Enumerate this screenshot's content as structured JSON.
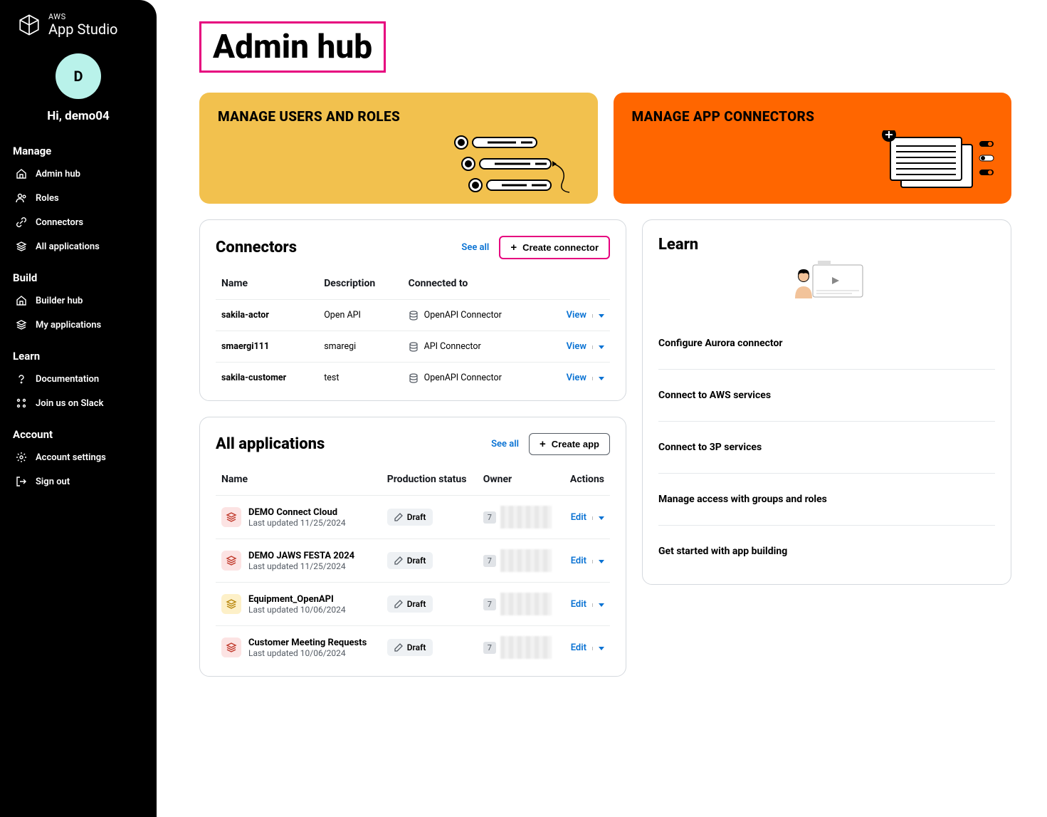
{
  "brand": {
    "small": "AWS",
    "big": "App Studio"
  },
  "user": {
    "initial": "D",
    "greeting": "Hi, demo04"
  },
  "nav": {
    "manage": {
      "heading": "Manage",
      "items": [
        "Admin hub",
        "Roles",
        "Connectors",
        "All applications"
      ]
    },
    "build": {
      "heading": "Build",
      "items": [
        "Builder hub",
        "My applications"
      ]
    },
    "learn": {
      "heading": "Learn",
      "items": [
        "Documentation",
        "Join us on Slack"
      ]
    },
    "account": {
      "heading": "Account",
      "items": [
        "Account settings",
        "Sign out"
      ]
    }
  },
  "page": {
    "title": "Admin hub"
  },
  "cards": {
    "users": "MANAGE USERS AND ROLES",
    "connectors": "MANAGE APP CONNECTORS"
  },
  "connectors": {
    "title": "Connectors",
    "see_all": "See all",
    "create": "Create connector",
    "cols": {
      "name": "Name",
      "desc": "Description",
      "conn": "Connected to"
    },
    "rows": [
      {
        "name": "sakila-actor",
        "desc": "Open API",
        "conn": "OpenAPI Connector",
        "action": "View"
      },
      {
        "name": "smaergi111",
        "desc": "smaregi",
        "conn": "API Connector",
        "action": "View"
      },
      {
        "name": "sakila-customer",
        "desc": "test",
        "conn": "OpenAPI Connector",
        "action": "View"
      }
    ]
  },
  "apps": {
    "title": "All applications",
    "see_all": "See all",
    "create": "Create app",
    "cols": {
      "name": "Name",
      "status": "Production status",
      "owner": "Owner",
      "actions": "Actions"
    },
    "status_label": "Draft",
    "owner_badge": "7",
    "edit": "Edit",
    "rows": [
      {
        "name": "DEMO Connect Cloud",
        "sub": "Last updated 11/25/2024",
        "color": "red"
      },
      {
        "name": "DEMO JAWS FESTA 2024",
        "sub": "Last updated 11/25/2024",
        "color": "red"
      },
      {
        "name": "Equipment_OpenAPI",
        "sub": "Last updated 10/06/2024",
        "color": "yellow"
      },
      {
        "name": "Customer Meeting Requests",
        "sub": "Last updated 10/06/2024",
        "color": "red"
      }
    ]
  },
  "learn": {
    "title": "Learn",
    "items": [
      "Configure Aurora connector",
      "Connect to AWS services",
      "Connect to 3P services",
      "Manage access with groups and roles",
      "Get started with app building"
    ]
  }
}
